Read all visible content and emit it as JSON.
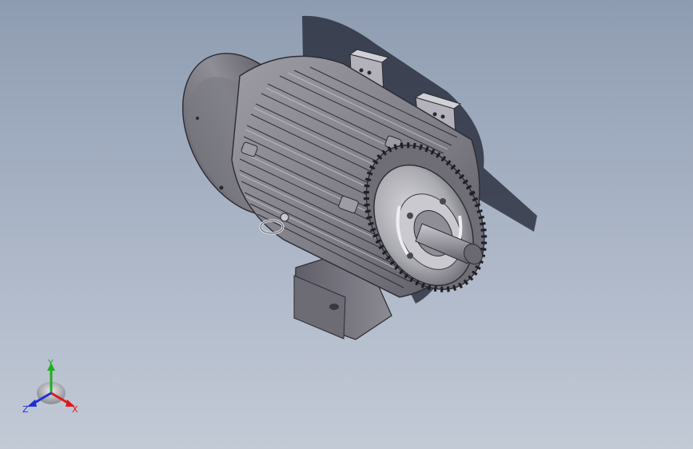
{
  "viewport": {
    "background_top": "#8e9cb1",
    "background_bottom": "#c3cad6"
  },
  "model": {
    "object": "electric-motor",
    "body_color": "#8b8a92",
    "shadow_color": "#1e2230"
  },
  "triad": {
    "x_label": "X",
    "y_label": "Y",
    "z_label": "Z",
    "x_color": "#e01818",
    "y_color": "#1fae1f",
    "z_color": "#1c2fd8"
  }
}
